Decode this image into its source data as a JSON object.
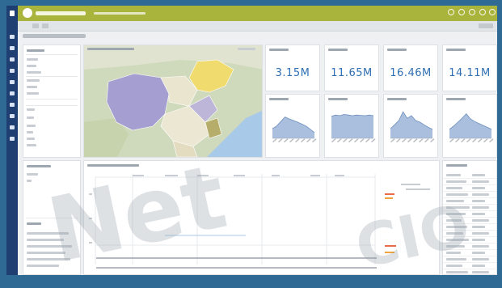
{
  "kpis": [
    {
      "value": "3.15M"
    },
    {
      "value": "11.65M"
    },
    {
      "value": "16.46M"
    },
    {
      "value": "14.11M"
    }
  ],
  "sparklines": [
    [
      0.3,
      0.38,
      0.52,
      0.66,
      0.6,
      0.55,
      0.5,
      0.44,
      0.38,
      0.28,
      0.18
    ],
    [
      0.68,
      0.72,
      0.7,
      0.74,
      0.72,
      0.7,
      0.72,
      0.71,
      0.7,
      0.72,
      0.7
    ],
    [
      0.3,
      0.42,
      0.55,
      0.82,
      0.62,
      0.7,
      0.55,
      0.5,
      0.42,
      0.34,
      0.28
    ],
    [
      0.28,
      0.38,
      0.5,
      0.62,
      0.76,
      0.6,
      0.52,
      0.46,
      0.4,
      0.34,
      0.28
    ]
  ],
  "watermark": {
    "text1": "Net",
    "text2": "CIO"
  },
  "colors": {
    "frame": "#2e6a93",
    "topbar": "#a9b43c",
    "sidebar": "#1f3f73",
    "kpi_value": "#2f6fb3",
    "area_fill": "#a9bfdd",
    "map_region_a": "#a59ed0",
    "map_region_b": "#f0dc6e"
  },
  "icons": [
    "menu-icon",
    "logo-icon",
    "user-icon",
    "settings-icon",
    "help-icon",
    "close-icon"
  ]
}
